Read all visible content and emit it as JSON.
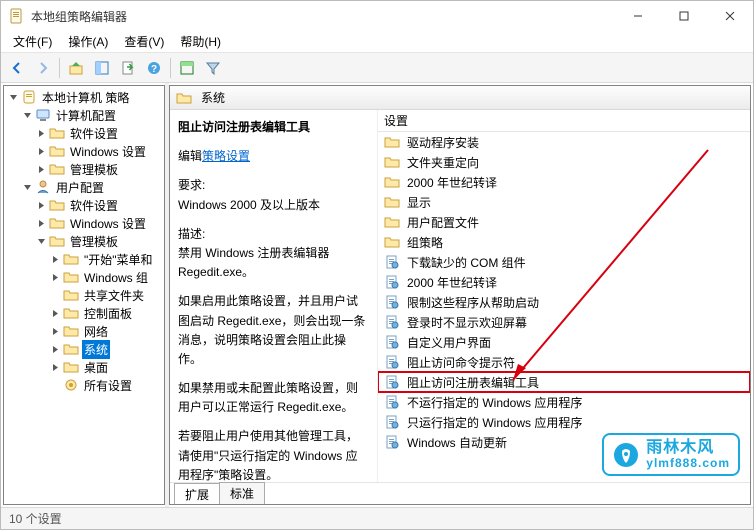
{
  "title": "本地组策略编辑器",
  "menus": {
    "file": "文件(F)",
    "action": "操作(A)",
    "view": "查看(V)",
    "help": "帮助(H)"
  },
  "tree": {
    "root": "本地计算机 策略",
    "cc": "计算机配置",
    "cc_soft": "软件设置",
    "cc_win": "Windows 设置",
    "cc_admin": "管理模板",
    "uc": "用户配置",
    "uc_soft": "软件设置",
    "uc_win": "Windows 设置",
    "uc_admin": "管理模板",
    "start": "\"开始\"菜单和",
    "wincomp": "Windows 组",
    "share": "共享文件夹",
    "cpanel": "控制面板",
    "net": "网络",
    "sys": "系统",
    "desk": "桌面",
    "allset": "所有设置"
  },
  "right_header": "系统",
  "desc": {
    "title": "阻止访问注册表编辑工具",
    "edit_label": "编辑",
    "edit_link": "策略设置",
    "req_label": "要求:",
    "req_text": "Windows 2000 及以上版本",
    "d_label": "描述:",
    "d1": "禁用 Windows 注册表编辑器 Regedit.exe。",
    "d2": "如果启用此策略设置，并且用户试图启动 Regedit.exe，则会出现一条消息，说明策略设置会阻止此操作。",
    "d3": "如果禁用或未配置此策略设置，则用户可以正常运行 Regedit.exe。",
    "d4": "若要阻止用户使用其他管理工具，请使用\"只运行指定的 Windows 应用程序\"策略设置。"
  },
  "col": "设置",
  "items": [
    {
      "t": "驱动程序安装",
      "k": "folder"
    },
    {
      "t": "文件夹重定向",
      "k": "folder"
    },
    {
      "t": "2000 年世纪转译",
      "k": "folder"
    },
    {
      "t": "显示",
      "k": "folder"
    },
    {
      "t": "用户配置文件",
      "k": "folder"
    },
    {
      "t": "组策略",
      "k": "folder"
    },
    {
      "t": "下载缺少的 COM 组件",
      "k": "pol"
    },
    {
      "t": "2000 年世纪转译",
      "k": "pol"
    },
    {
      "t": "限制这些程序从帮助启动",
      "k": "pol"
    },
    {
      "t": "登录时不显示欢迎屏幕",
      "k": "pol"
    },
    {
      "t": "自定义用户界面",
      "k": "pol"
    },
    {
      "t": "阻止访问命令提示符",
      "k": "pol"
    },
    {
      "t": "阻止访问注册表编辑工具",
      "k": "pol",
      "hl": true
    },
    {
      "t": "不运行指定的 Windows 应用程序",
      "k": "pol"
    },
    {
      "t": "只运行指定的 Windows 应用程序",
      "k": "pol"
    },
    {
      "t": "Windows 自动更新",
      "k": "pol"
    }
  ],
  "tabs": {
    "ext": "扩展",
    "std": "标准"
  },
  "status": "10 个设置",
  "watermark": {
    "l1": "雨林木风",
    "l2": "ylmf888.com"
  }
}
